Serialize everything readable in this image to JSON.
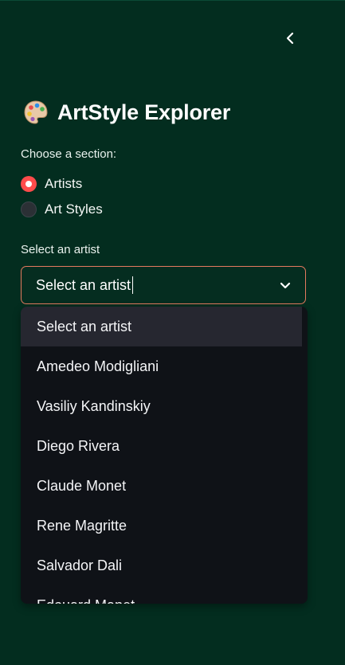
{
  "sidebar": {
    "title": "ArtStyle Explorer",
    "title_icon": "palette-icon",
    "collapse_icon": "chevron-left-icon",
    "section_label": "Choose a section:",
    "radio_options": [
      {
        "label": "Artists",
        "selected": true
      },
      {
        "label": "Art Styles",
        "selected": false
      }
    ],
    "select": {
      "label": "Select an artist",
      "value": "Select an artist",
      "icon": "chevron-down-icon"
    },
    "dropdown_options": [
      "Select an artist",
      "Amedeo Modigliani",
      "Vasiliy Kandinskiy",
      "Diego Rivera",
      "Claude Monet",
      "Rene Magritte",
      "Salvador Dali",
      "Edouard Manet"
    ]
  },
  "colors": {
    "background": "#032d1f",
    "radio_accent": "#ff4b4b",
    "select_border": "#e57a5f",
    "dropdown_bg": "#0f1217",
    "option_highlight": "#262730"
  }
}
